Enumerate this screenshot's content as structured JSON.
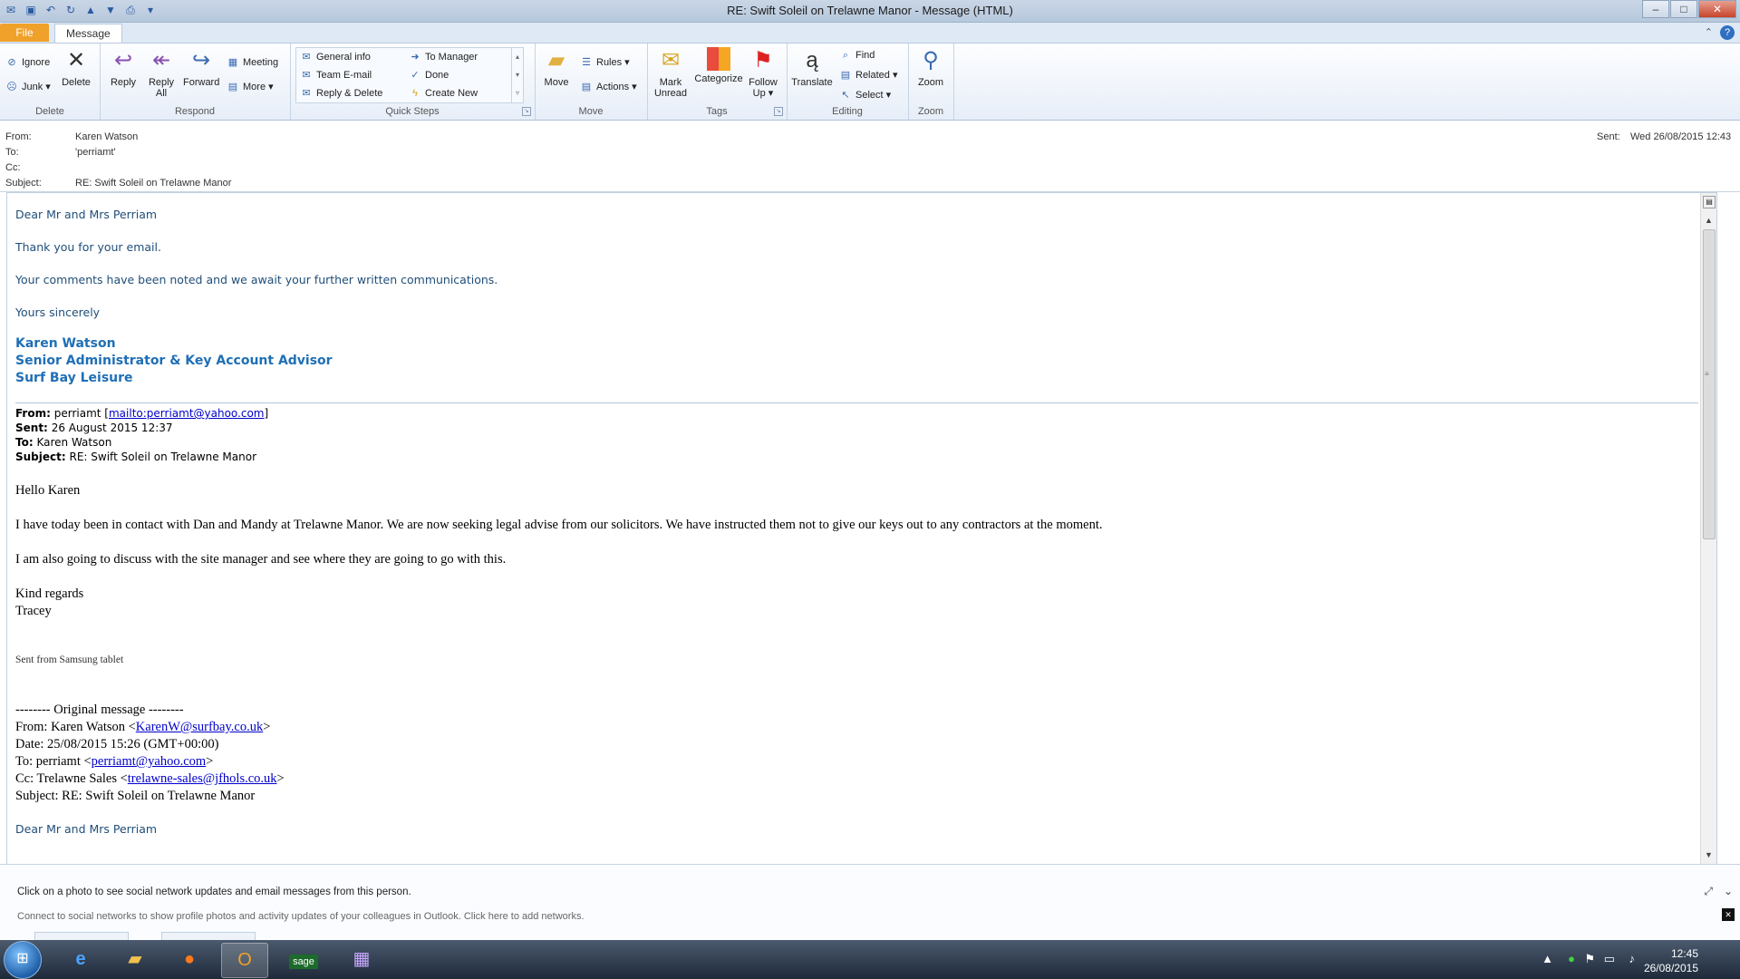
{
  "window": {
    "title": "RE: Swift Soleil on Trelawne Manor  -  Message (HTML)",
    "minimize": "–",
    "maximize": "□",
    "close": "✕"
  },
  "tabs": {
    "file": "File",
    "message": "Message"
  },
  "ribbon": {
    "delete_group": {
      "label": "Delete",
      "ignore": "Ignore",
      "junk": "Junk ▾",
      "delete": "Delete"
    },
    "respond_group": {
      "label": "Respond",
      "reply": "Reply",
      "reply_all": "Reply All",
      "forward": "Forward",
      "meeting": "Meeting",
      "more": "More ▾"
    },
    "quicksteps_group": {
      "label": "Quick Steps",
      "items": [
        "General info",
        "Team E-mail",
        "Reply & Delete",
        "To Manager",
        "Done",
        "Create New"
      ]
    },
    "move_group": {
      "label": "Move",
      "move": "Move",
      "rules": "Rules ▾",
      "actions": "Actions ▾"
    },
    "tags_group": {
      "label": "Tags",
      "mark_unread": "Mark Unread",
      "categorize": "Categorize",
      "follow_up": "Follow Up ▾"
    },
    "editing_group": {
      "label": "Editing",
      "translate": "Translate",
      "find": "Find",
      "related": "Related ▾",
      "select": "Select ▾"
    },
    "zoom_group": {
      "label": "Zoom",
      "zoom": "Zoom"
    }
  },
  "header": {
    "from_label": "From:",
    "from_value": "Karen Watson",
    "to_label": "To:",
    "to_value": "'perriamt'",
    "cc_label": "Cc:",
    "subject_label": "Subject:",
    "subject_value": "RE: Swift Soleil on Trelawne Manor",
    "sent_label": "Sent:",
    "sent_value": "Wed 26/08/2015 12:43"
  },
  "body": {
    "greeting": "Dear Mr and Mrs Perriam",
    "line1": "Thank you for your email.",
    "line2": "Your comments have been noted and we await your further written communications.",
    "closing": "Yours sincerely",
    "sig_name": "Karen Watson",
    "sig_title": "Senior Administrator & Key Account Advisor",
    "sig_company": "Surf Bay Leisure",
    "fwd": {
      "from_label": "From:",
      "from_name": "perriamt",
      "from_link": "mailto:perriamt@yahoo.com",
      "sent_label": "Sent:",
      "sent_value": "26 August 2015 12:37",
      "to_label": "To:",
      "to_value": "Karen Watson",
      "subject_label": "Subject:",
      "subject_value": "RE: Swift Soleil on Trelawne Manor"
    },
    "reply_greeting": "Hello Karen",
    "reply_p1": "I have today been in contact with Dan and Mandy at Trelawne Manor.  We are now seeking legal advise from our solicitors.  We have instructed them not to give our keys out to any contractors at the moment.",
    "reply_p2": "I am also going to discuss with the site manager and see where they are going to go with this.",
    "reply_regards": "Kind regards",
    "reply_name": "Tracey",
    "reply_sent_from": "Sent from Samsung tablet",
    "orig": {
      "divider": "-------- Original message --------",
      "from_prefix": "From: Karen Watson <",
      "from_email": "KarenW@surfbay.co.uk",
      "date": "Date: 25/08/2015 15:26 (GMT+00:00)",
      "to_prefix": "To: perriamt <",
      "to_email": "perriamt@yahoo.com",
      "cc_prefix": "Cc: Trelawne Sales <",
      "cc_email": "trelawne-sales@jfhols.co.uk",
      "subject": "Subject: RE: Swift Soleil on Trelawne Manor",
      "greeting": "Dear Mr and Mrs Perriam"
    }
  },
  "people_pane": {
    "line1": "Click on a photo to see social network updates and email messages from this person.",
    "line2": "Connect to social networks to show profile photos and activity updates of your colleagues in Outlook. Click here to add networks."
  },
  "taskbar": {
    "time": "12:45",
    "date": "26/08/2015",
    "apps": [
      "internet-explorer",
      "file-explorer",
      "firefox",
      "outlook",
      "sage",
      "calculator"
    ]
  }
}
